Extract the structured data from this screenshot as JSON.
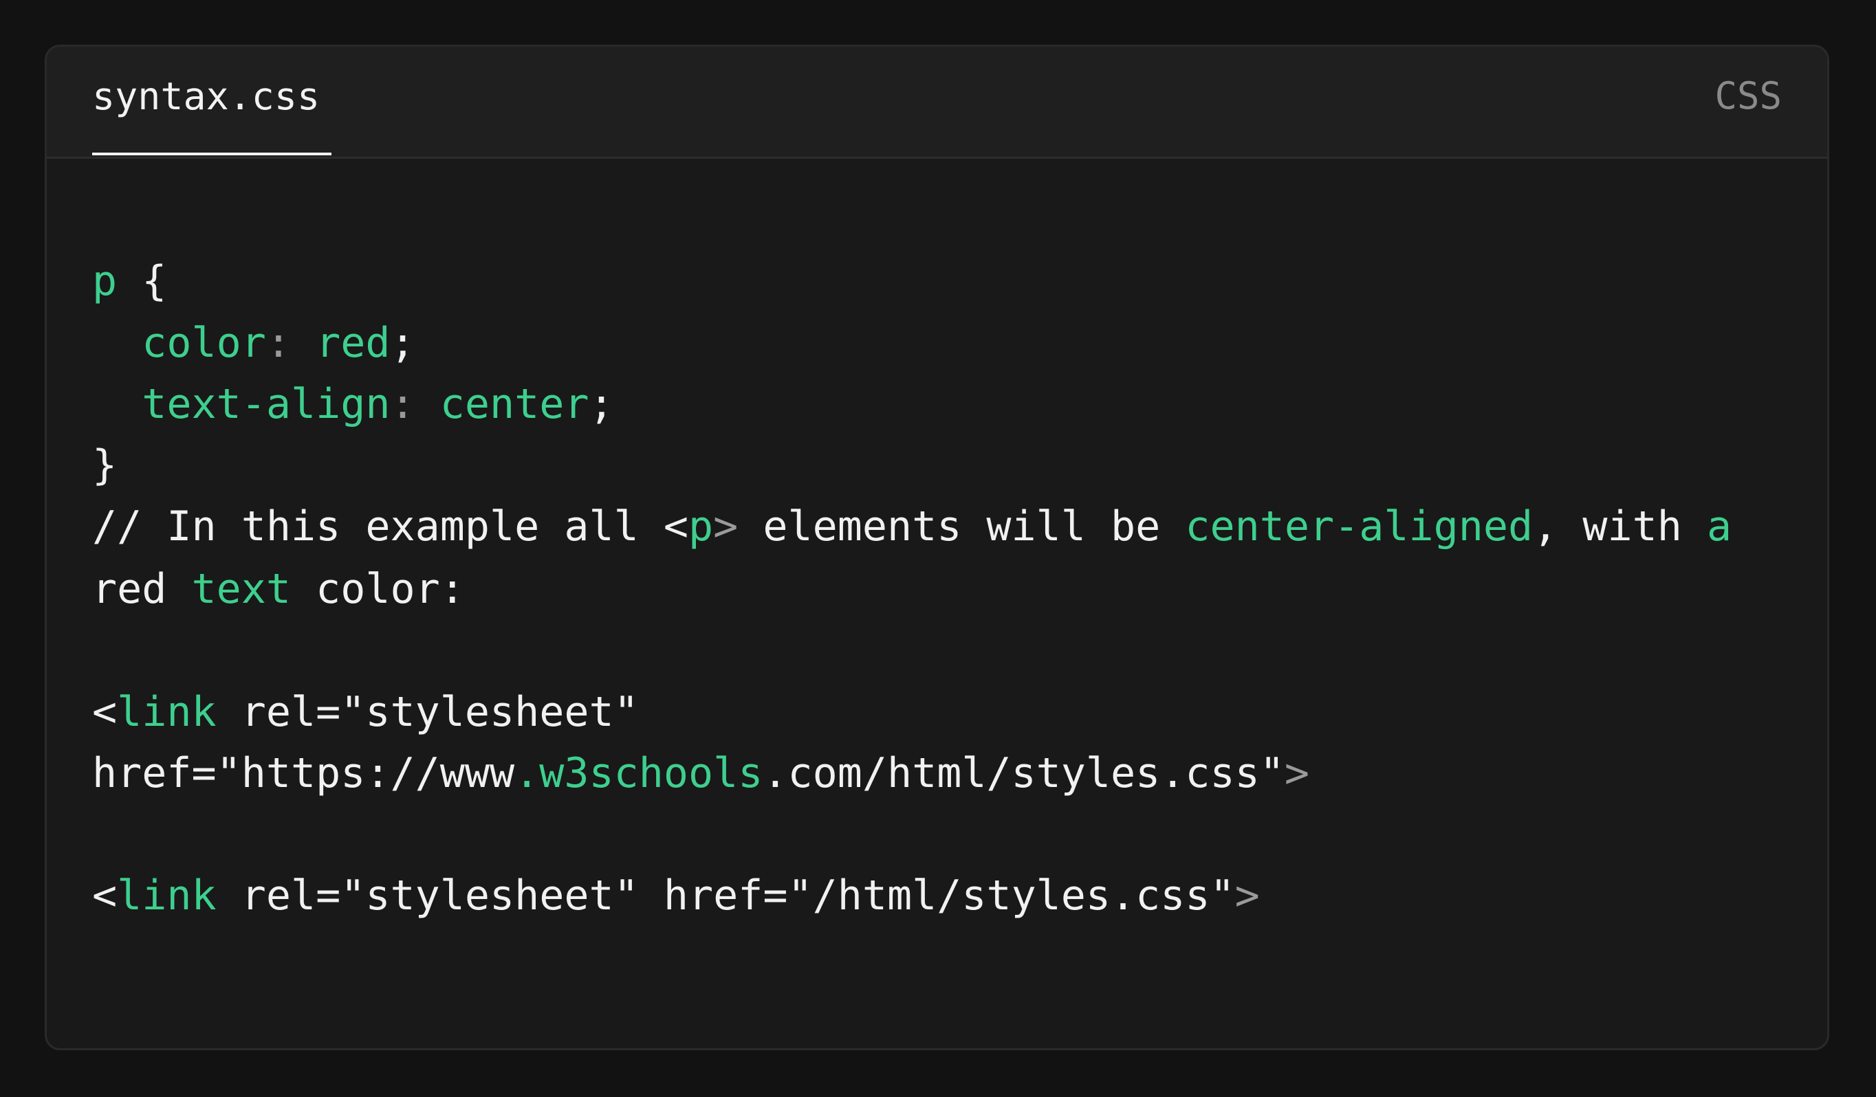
{
  "file_tab": {
    "label": "syntax.css"
  },
  "language_label": "CSS",
  "accent_color": "#3ecf8e",
  "code_lines": [
    {
      "segments": [
        {
          "text": "p",
          "hl": "g"
        },
        {
          "text": " {"
        }
      ]
    },
    {
      "segments": [
        {
          "text": "  "
        },
        {
          "text": "color",
          "hl": "g"
        },
        {
          "text": ": ",
          "hl": "m"
        },
        {
          "text": "red",
          "hl": "g"
        },
        {
          "text": ";"
        }
      ]
    },
    {
      "segments": [
        {
          "text": "  "
        },
        {
          "text": "text-align",
          "hl": "g"
        },
        {
          "text": ": ",
          "hl": "m"
        },
        {
          "text": "center",
          "hl": "g"
        },
        {
          "text": ";"
        }
      ]
    },
    {
      "segments": [
        {
          "text": "}"
        }
      ]
    },
    {
      "segments": [
        {
          "text": "// In this example all <"
        },
        {
          "text": "p",
          "hl": "g"
        },
        {
          "text": ">",
          "hl": "m"
        },
        {
          "text": " elements will be "
        },
        {
          "text": "center-aligned",
          "hl": "g"
        },
        {
          "text": ", with "
        },
        {
          "text": "a",
          "hl": "g"
        }
      ]
    },
    {
      "segments": [
        {
          "text": "red "
        },
        {
          "text": "text",
          "hl": "g"
        },
        {
          "text": " color:"
        }
      ]
    },
    {
      "segments": []
    },
    {
      "segments": [
        {
          "text": "<"
        },
        {
          "text": "link",
          "hl": "g"
        },
        {
          "text": " rel=\"stylesheet\""
        }
      ]
    },
    {
      "segments": [
        {
          "text": "href=\"https://www"
        },
        {
          "text": ".w3schools",
          "hl": "g"
        },
        {
          "text": ".com/html/styles.css\""
        },
        {
          "text": ">",
          "hl": "m"
        }
      ]
    },
    {
      "segments": []
    },
    {
      "segments": [
        {
          "text": "<"
        },
        {
          "text": "link",
          "hl": "g"
        },
        {
          "text": " rel=\"stylesheet\" href=\"/html/styles.css\""
        },
        {
          "text": ">",
          "hl": "m"
        }
      ]
    }
  ]
}
